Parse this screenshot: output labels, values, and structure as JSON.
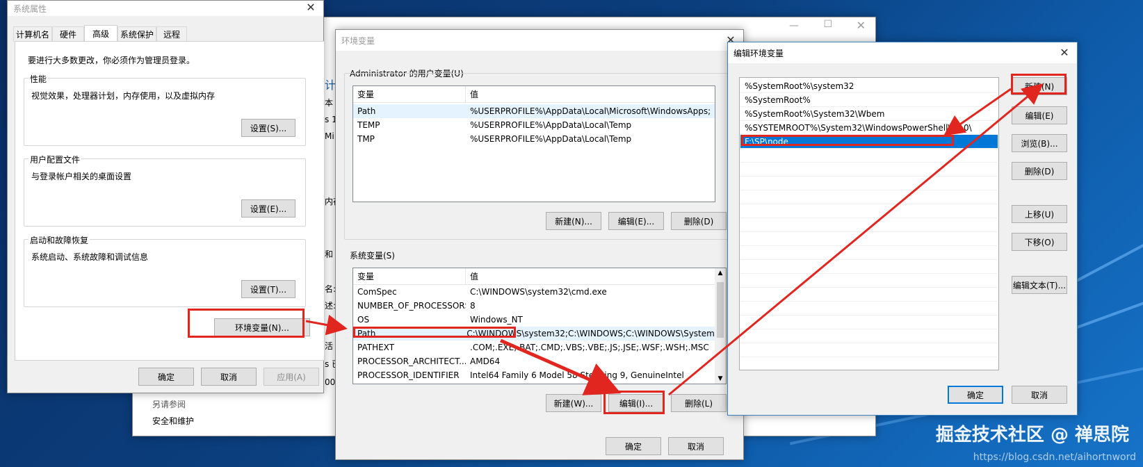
{
  "sys_props": {
    "title": "系统属性",
    "tabs": [
      "计算机名",
      "硬件",
      "高级",
      "系统保护",
      "远程"
    ],
    "admin_note": "要进行大多数更改，你必须作为管理员登录。",
    "groups": [
      {
        "label": "性能",
        "desc": "视觉效果，处理器计划，内存使用，以及虚拟内存",
        "button": "设置(S)..."
      },
      {
        "label": "用户配置文件",
        "desc": "与登录帐户相关的桌面设置",
        "button": "设置(E)..."
      },
      {
        "label": "启动和故障恢复",
        "desc": "系统启动、系统故障和调试信息",
        "button": "设置(T)..."
      }
    ],
    "env_button": "环境变量(N)...",
    "ok": "确定",
    "cancel": "取消",
    "apply": "应用(A)"
  },
  "bg_window": {
    "partial_texts": [
      "计算",
      "本",
      "s 1",
      "Mi",
      "内存",
      "和",
      "名:",
      "述:",
      "活",
      "s 已",
      "00"
    ],
    "see_also": "另请参阅",
    "security": "安全和维护"
  },
  "env_vars": {
    "title": "环境变量",
    "user_group_label": "Administrator 的用户变量(U)",
    "col_var": "变量",
    "col_val": "值",
    "user_vars": [
      {
        "name": "Path",
        "value": "%USERPROFILE%\\AppData\\Local\\Microsoft\\WindowsApps;"
      },
      {
        "name": "TEMP",
        "value": "%USERPROFILE%\\AppData\\Local\\Temp"
      },
      {
        "name": "TMP",
        "value": "%USERPROFILE%\\AppData\\Local\\Temp"
      }
    ],
    "user_new": "新建(N)...",
    "user_edit": "编辑(E)...",
    "user_delete": "删除(D)",
    "sys_group_label": "系统变量(S)",
    "sys_vars": [
      {
        "name": "ComSpec",
        "value": "C:\\WINDOWS\\system32\\cmd.exe"
      },
      {
        "name": "NUMBER_OF_PROCESSORS",
        "value": "8"
      },
      {
        "name": "OS",
        "value": "Windows_NT"
      },
      {
        "name": "Path",
        "value": "C:\\WINDOWS\\system32;C:\\WINDOWS;C:\\WINDOWS\\System..."
      },
      {
        "name": "PATHEXT",
        "value": ".COM;.EXE;.BAT;.CMD;.VBS;.VBE;.JS;.JSE;.WSF;.WSH;.MSC"
      },
      {
        "name": "PROCESSOR_ARCHITECT...",
        "value": "AMD64"
      },
      {
        "name": "PROCESSOR_IDENTIFIER",
        "value": "Intel64 Family 6 Model 58 Stepping 9, GenuineIntel"
      }
    ],
    "sys_new": "新建(W)...",
    "sys_edit": "编辑(I)...",
    "sys_delete": "删除(L)",
    "ok": "确定",
    "cancel": "取消"
  },
  "edit_env": {
    "title": "编辑环境变量",
    "entries": [
      "%SystemRoot%\\system32",
      "%SystemRoot%",
      "%SystemRoot%\\System32\\Wbem",
      "%SYSTEMROOT%\\System32\\WindowsPowerShell\\v1.0\\",
      "F:\\SP\\node"
    ],
    "buttons": {
      "new": "新建(N)",
      "edit": "编辑(E)",
      "browse": "浏览(B)...",
      "delete": "删除(D)",
      "move_up": "上移(U)",
      "move_down": "下移(O)",
      "edit_text": "编辑文本(T)..."
    },
    "ok": "确定",
    "cancel": "取消"
  },
  "watermark": {
    "text": "掘金技术社区 @ 禅思院",
    "url": "https://blog.csdn.net/aihortnword"
  },
  "colors": {
    "highlight": "#e0261e",
    "selection": "#0078d7"
  }
}
